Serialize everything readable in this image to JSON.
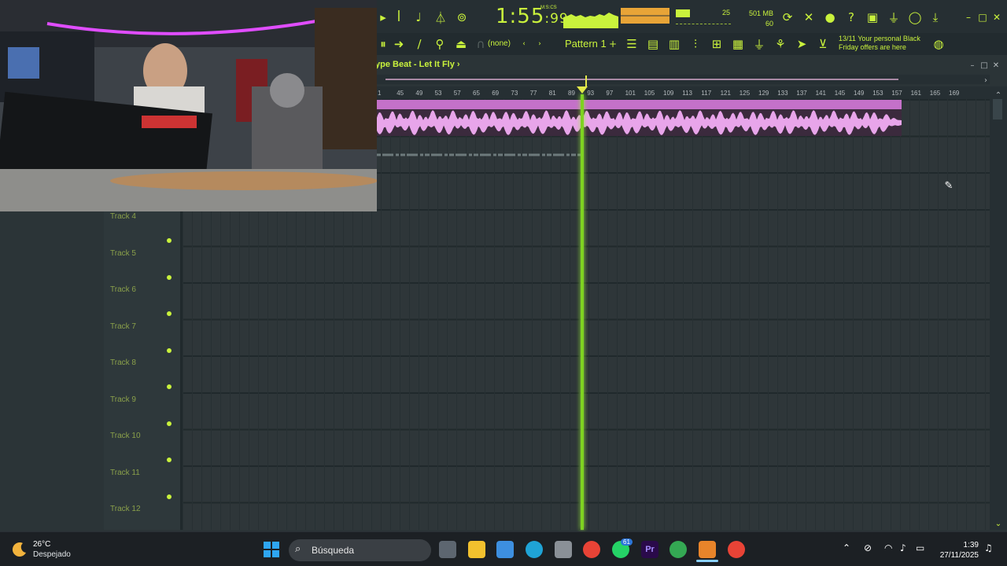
{
  "toolbar": {
    "time": "1:55",
    "time_fraction": ":99",
    "time_unit": "M:S:CS",
    "cpu": "25",
    "memory": "501 MB",
    "polyphony": "60",
    "pattern": "Pattern 1",
    "pattern_plus": "+",
    "none_label": "(none)",
    "promo_date": "13/11",
    "promo_text": "Your personal Black Friday offers are here",
    "colors": {
      "accent": "#c9f23c",
      "meter": "#e8a437"
    }
  },
  "playlist": {
    "title": "ype Beat - Let It Fly",
    "title_arrow": "›",
    "ruler": [
      "1",
      "45",
      "49",
      "53",
      "57",
      "65",
      "69",
      "73",
      "77",
      "81",
      "89",
      "93",
      "97",
      "101",
      "105",
      "109",
      "113",
      "117",
      "121",
      "125",
      "129",
      "133",
      "137",
      "141",
      "145",
      "149",
      "153",
      "157",
      "161",
      "165",
      "169"
    ],
    "tracks": [
      "Track 4",
      "Track 5",
      "Track 6",
      "Track 7",
      "Track 8",
      "Track 9",
      "Track 10",
      "Track 11",
      "Track 12"
    ],
    "colors": {
      "audio_clip": "#c471c9",
      "playhead": "#7ed321"
    }
  },
  "taskbar": {
    "temperature": "26°C",
    "weather": "Despejado",
    "search_placeholder": "Búsqueda",
    "whatsapp_badge": "61",
    "time": "1:39",
    "date": "27/11/2025"
  }
}
